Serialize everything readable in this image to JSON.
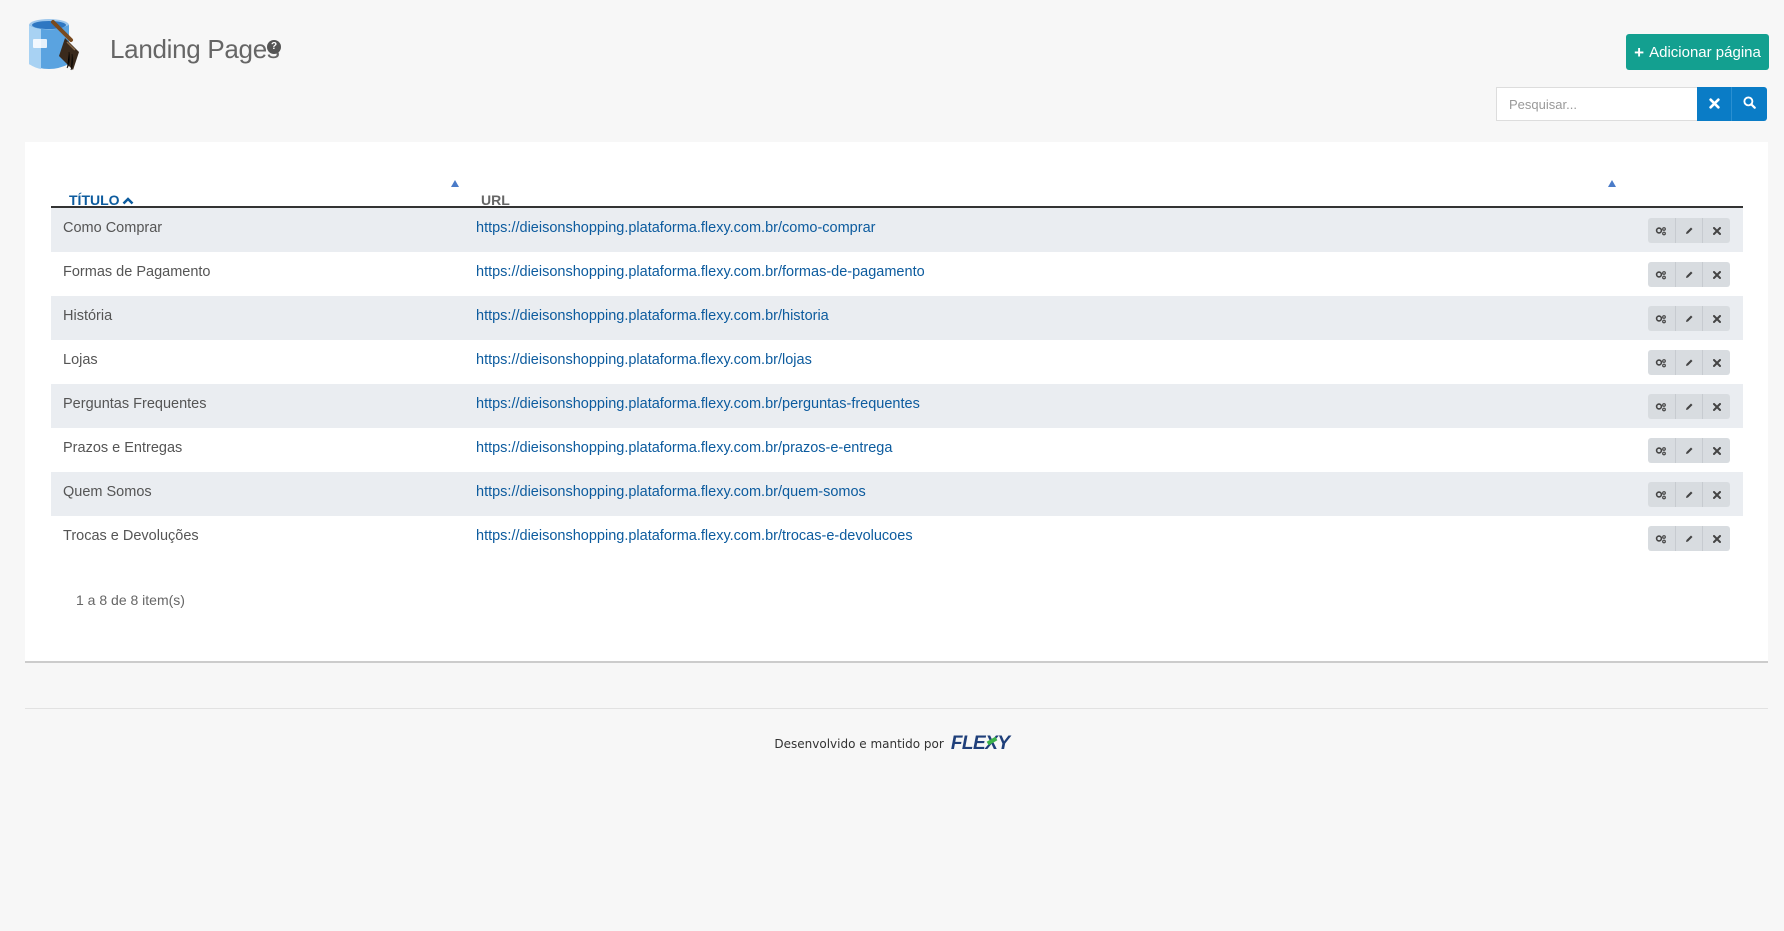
{
  "header": {
    "title": "Landing Pages",
    "help_icon": "question-circle-icon",
    "app_icon": "paint-bucket-brush-icon",
    "add_button_label": "Adicionar página",
    "add_button_color": "#13a090"
  },
  "search": {
    "placeholder": "Pesquisar...",
    "value": "",
    "accent_color": "#0a7cc6"
  },
  "table": {
    "columns": {
      "title": "TÍTULO",
      "url": "URL"
    },
    "sort": {
      "column": "title",
      "direction": "asc"
    },
    "rows": [
      {
        "title": "Como Comprar",
        "url": "https://dieisonshopping.plataforma.flexy.com.br/como-comprar"
      },
      {
        "title": "Formas de Pagamento",
        "url": "https://dieisonshopping.plataforma.flexy.com.br/formas-de-pagamento"
      },
      {
        "title": "História",
        "url": "https://dieisonshopping.plataforma.flexy.com.br/historia"
      },
      {
        "title": "Lojas",
        "url": "https://dieisonshopping.plataforma.flexy.com.br/lojas"
      },
      {
        "title": "Perguntas Frequentes",
        "url": "https://dieisonshopping.plataforma.flexy.com.br/perguntas-frequentes"
      },
      {
        "title": "Prazos e Entregas",
        "url": "https://dieisonshopping.plataforma.flexy.com.br/prazos-e-entrega"
      },
      {
        "title": "Quem Somos",
        "url": "https://dieisonshopping.plataforma.flexy.com.br/quem-somos"
      },
      {
        "title": "Trocas e Devoluções",
        "url": "https://dieisonshopping.plataforma.flexy.com.br/trocas-e-devolucoes"
      }
    ],
    "row_actions": [
      "settings-icon",
      "edit-icon",
      "delete-icon"
    ],
    "pager_info": "1 a 8 de 8 item(s)"
  },
  "footer": {
    "text": "Desenvolvido e mantido por",
    "logo_text": "FLEXY"
  }
}
